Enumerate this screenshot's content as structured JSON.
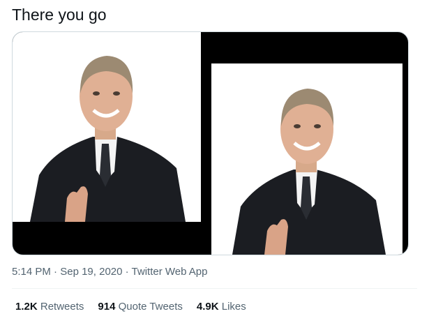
{
  "tweet": {
    "text": "There you go"
  },
  "media": {
    "left_alt": "Photo",
    "right_alt": "Photo"
  },
  "meta": {
    "time": "5:14 PM",
    "sep1": " · ",
    "date": "Sep 19, 2020",
    "sep2": " · ",
    "source": "Twitter Web App"
  },
  "stats": {
    "retweets_count": "1.2K",
    "retweets_label": "Retweets",
    "quotes_count": "914",
    "quotes_label": "Quote Tweets",
    "likes_count": "4.9K",
    "likes_label": "Likes"
  }
}
